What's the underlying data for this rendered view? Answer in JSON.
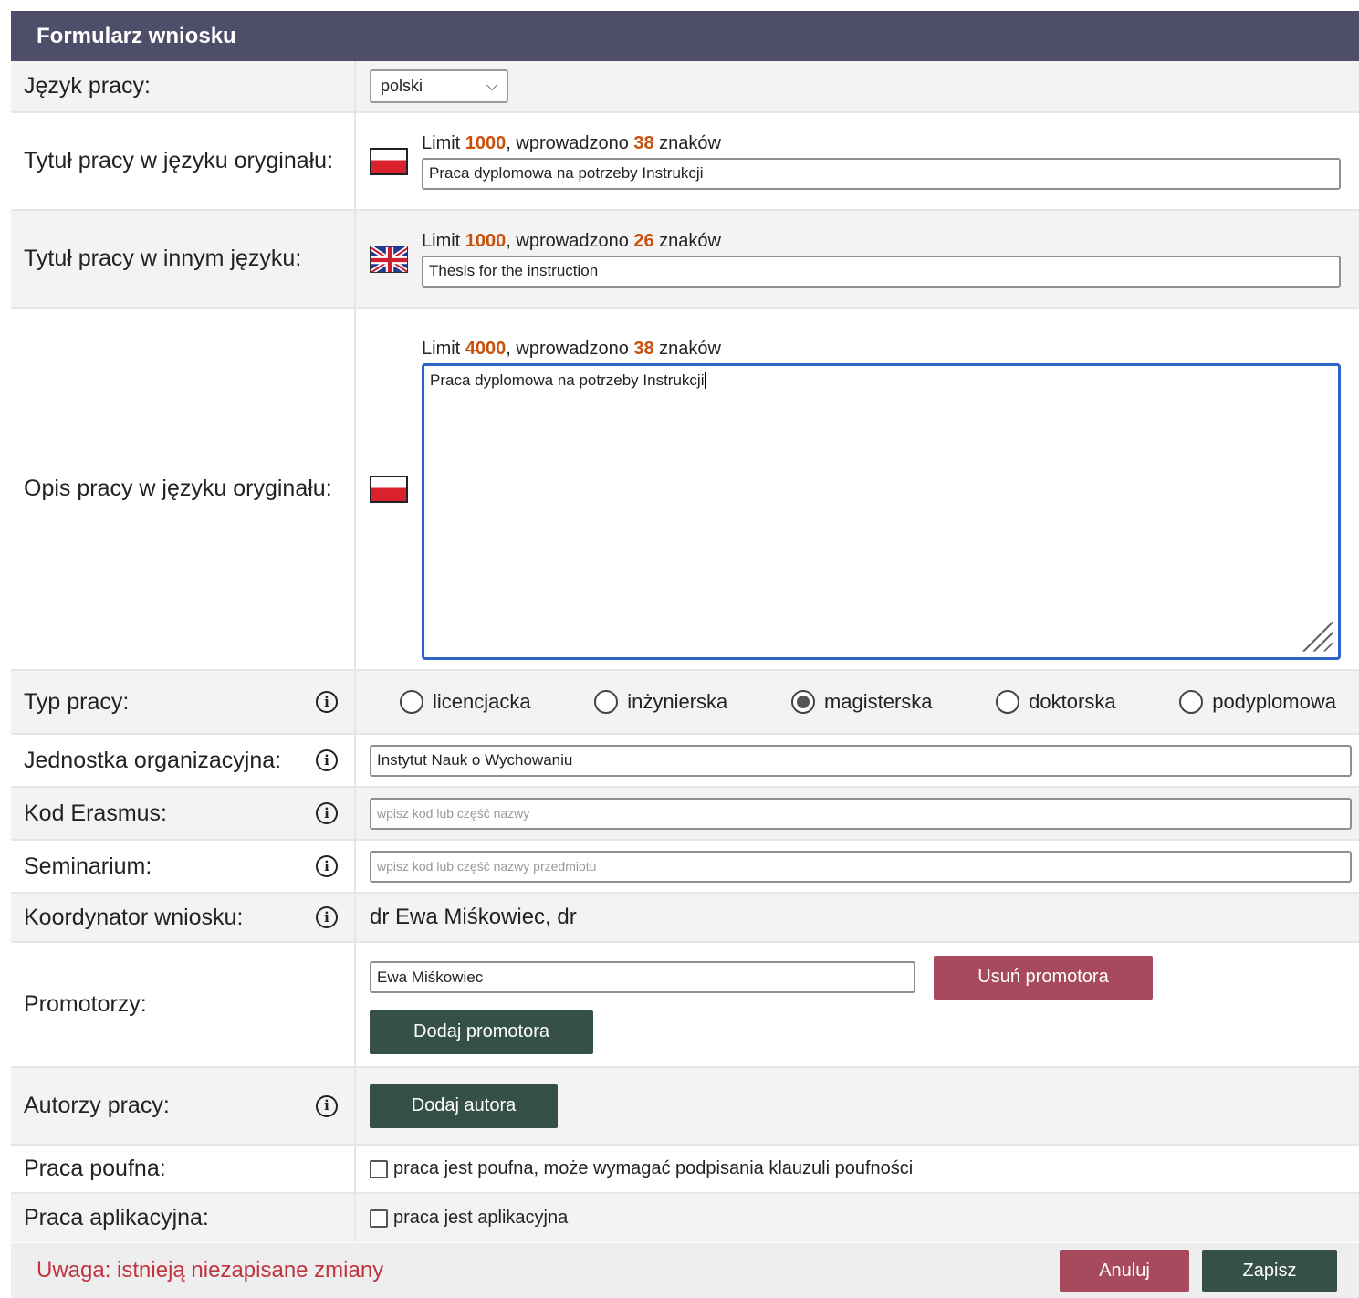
{
  "header": {
    "title": "Formularz wniosku"
  },
  "language": {
    "label": "Język pracy:",
    "selected": "polski"
  },
  "title_original": {
    "label": "Tytuł pracy w języku oryginału:",
    "limit_prefix": "Limit ",
    "limit": "1000",
    "limit_mid": ", wprowadzono ",
    "count": "38",
    "limit_suffix": " znaków",
    "value": "Praca dyplomowa na potrzeby Instrukcji"
  },
  "title_other": {
    "label": "Tytuł pracy w innym języku:",
    "limit_prefix": "Limit ",
    "limit": "1000",
    "limit_mid": ", wprowadzono ",
    "count": "26",
    "limit_suffix": " znaków",
    "value": "Thesis for the instruction"
  },
  "description": {
    "label": "Opis pracy w języku oryginału:",
    "limit_prefix": "Limit ",
    "limit": "4000",
    "limit_mid": ", wprowadzono ",
    "count": "38",
    "limit_suffix": " znaków",
    "value": "Praca dyplomowa na potrzeby Instrukcji"
  },
  "thesis_type": {
    "label": "Typ pracy:",
    "options": [
      "licencjacka",
      "inżynierska",
      "magisterska",
      "doktorska",
      "podyplomowa"
    ],
    "selected": "magisterska"
  },
  "unit": {
    "label": "Jednostka organizacyjna:",
    "value": "Instytut Nauk o Wychowaniu"
  },
  "erasmus": {
    "label": "Kod Erasmus:",
    "placeholder": "wpisz kod lub część nazwy"
  },
  "seminar": {
    "label": "Seminarium:",
    "placeholder": "wpisz kod lub część nazwy przedmiotu"
  },
  "coordinator": {
    "label": "Koordynator wniosku:",
    "value": "dr Ewa Miśkowiec, dr"
  },
  "supervisors": {
    "label": "Promotorzy:",
    "value": "Ewa Miśkowiec",
    "remove_label": "Usuń promotora",
    "add_label": "Dodaj promotora"
  },
  "authors": {
    "label": "Autorzy pracy:",
    "add_label": "Dodaj autora"
  },
  "confidential": {
    "label": "Praca poufna:",
    "checkbox_label": "praca jest poufna, może wymagać podpisania klauzuli poufności"
  },
  "applied": {
    "label": "Praca aplikacyjna:",
    "checkbox_label": "praca jest aplikacyjna"
  },
  "footer": {
    "warning": "Uwaga: istnieją niezapisane zmiany",
    "cancel_label": "Anuluj",
    "save_label": "Zapisz"
  },
  "colors": {
    "header": "#4e4e6a",
    "accent_number": "#c8500a",
    "green_button": "#355048",
    "red_button": "#a84a5e",
    "warning": "#c0343f"
  }
}
